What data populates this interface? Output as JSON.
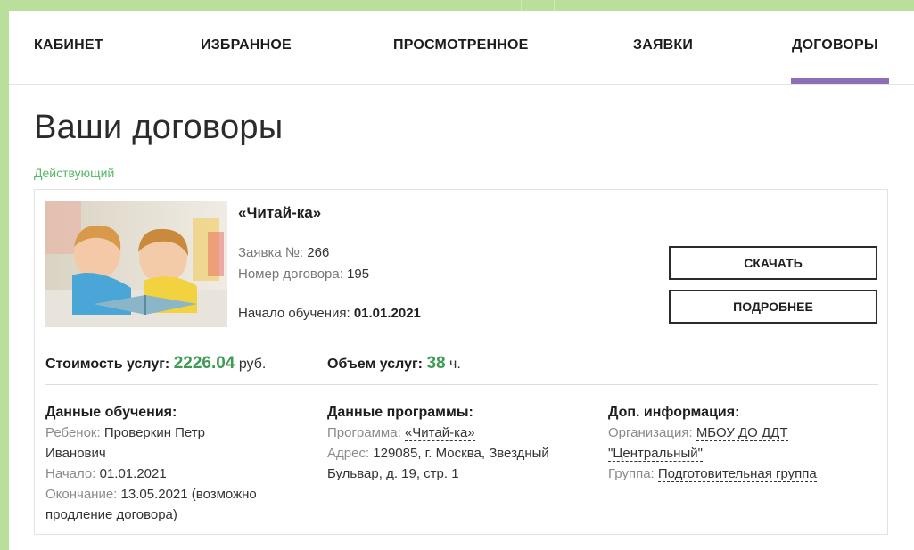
{
  "nav": {
    "items": [
      {
        "label": "КАБИНЕТ"
      },
      {
        "label": "ИЗБРАННОЕ"
      },
      {
        "label": "ПРОСМОТРЕННОЕ"
      },
      {
        "label": "ЗАЯВКИ"
      },
      {
        "label": "ДОГОВОРЫ"
      }
    ],
    "active": "ДОГОВОРЫ",
    "accent": "#8d6fb8"
  },
  "page": {
    "title": "Ваши договоры",
    "status": "Действующий"
  },
  "contract": {
    "name": "«Читай-ка»",
    "application_label": "Заявка №:",
    "application_value": "266",
    "contract_label": "Номер договора:",
    "contract_value": "195",
    "start_label": "Начало обучения:",
    "start_value": "01.01.2021",
    "download_button": "СКАЧАТЬ",
    "details_button": "ПОДРОБНЕЕ",
    "cost_label": "Стоимость услуг:",
    "cost_value": "2226.04",
    "cost_unit": "руб.",
    "volume_label": "Объем услуг:",
    "volume_value": "38",
    "volume_unit": "ч.",
    "study": {
      "heading": "Данные обучения:",
      "child_label": "Ребенок:",
      "child_value_1": "Проверкин Петр",
      "child_value_2": "Иванович",
      "begin_label": "Начало:",
      "begin_value": "01.01.2021",
      "end_label": "Окончание:",
      "end_value_1": "13.05.2021 (возможно",
      "end_value_2": "продление договора)"
    },
    "program": {
      "heading": "Данные программы:",
      "program_label": "Программа:",
      "program_value": "«Читай-ка»",
      "address_label": "Адрес:",
      "address_value_1": "129085, г. Москва, Звездный",
      "address_value_2": "Бульвар, д. 19, стр. 1"
    },
    "extra": {
      "heading": "Доп. информация:",
      "org_label": "Организация:",
      "org_value_1": "МБОУ ДО ДДТ",
      "org_value_2": "\"Центральный\"",
      "group_label": "Группа:",
      "group_value": "Подготовительная группа"
    }
  },
  "colors": {
    "status_green": "#56b866",
    "number_green": "#3f9a55",
    "page_bg": "#b9df9a"
  }
}
